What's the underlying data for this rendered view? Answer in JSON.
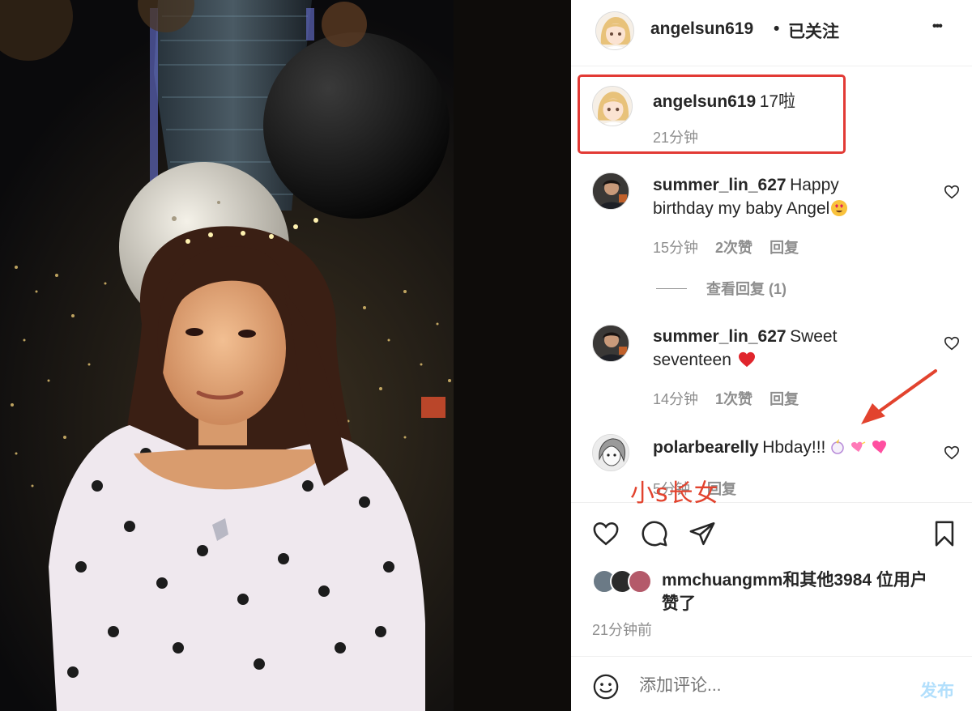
{
  "post": {
    "author": "angelsun619",
    "follow_separator": "•",
    "follow_status": "已关注",
    "more_label": "•••",
    "caption": {
      "username": "angelsun619",
      "text": "17啦",
      "time": "21分钟"
    }
  },
  "comments": [
    {
      "username": "summer_lin_627",
      "text_line1": "Happy",
      "text_line2": "birthday my baby Angel",
      "emoji": "heart-eyes-emoji",
      "time": "15分钟",
      "likes": "2次赞",
      "reply": "回复",
      "view_replies": "查看回复 (1)"
    },
    {
      "username": "summer_lin_627",
      "text_line1": "Sweet",
      "text_line2": "seventeen",
      "emoji": "red-heart-emoji",
      "time": "14分钟",
      "likes": "1次赞",
      "reply": "回复"
    },
    {
      "username": "polarbearelly",
      "text": "Hbday!!!",
      "emoji": "unicorn-hearts-emoji",
      "time": "5分钟",
      "reply": "回复"
    }
  ],
  "likes_summary": {
    "text_line1": "mmchuangmm和其他3984 位用户",
    "text_line2": "赞了"
  },
  "post_time": "21分钟前",
  "comment_input": {
    "placeholder": "添加评论...",
    "submit": "发布"
  },
  "watermark": "小s长女",
  "colors": {
    "highlight": "#e23a35",
    "submit_disabled": "#b2dffc",
    "meta_gray": "#8e8e8e"
  }
}
